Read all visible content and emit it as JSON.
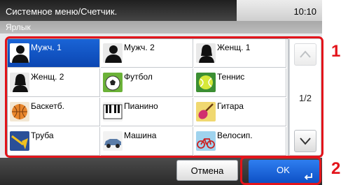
{
  "header": {
    "title": "Системное меню/Счетчик.",
    "time": "10:10"
  },
  "subheader": {
    "title": "Ярлык"
  },
  "icons": [
    {
      "label": "Мужч. 1",
      "icon": "man-silhouette-icon",
      "selected": true
    },
    {
      "label": "Мужч. 2",
      "icon": "man-silhouette-icon",
      "selected": false
    },
    {
      "label": "Женщ. 1",
      "icon": "woman-silhouette-icon",
      "selected": false
    },
    {
      "label": "Женщ. 2",
      "icon": "woman-silhouette-icon",
      "selected": false
    },
    {
      "label": "Футбол",
      "icon": "soccer-ball-icon",
      "selected": false
    },
    {
      "label": "Теннис",
      "icon": "tennis-ball-icon",
      "selected": false
    },
    {
      "label": "Баскетб.",
      "icon": "basketball-icon",
      "selected": false
    },
    {
      "label": "Пианино",
      "icon": "piano-keys-icon",
      "selected": false
    },
    {
      "label": "Гитара",
      "icon": "guitar-icon",
      "selected": false
    },
    {
      "label": "Труба",
      "icon": "trumpet-icon",
      "selected": false
    },
    {
      "label": "Машина",
      "icon": "car-icon",
      "selected": false
    },
    {
      "label": "Велосип.",
      "icon": "bicycle-icon",
      "selected": false
    }
  ],
  "scroll": {
    "page": "1/2"
  },
  "footer": {
    "cancel_label": "Отмена",
    "ok_label": "OK"
  },
  "callouts": {
    "grid_number": "1",
    "ok_number": "2"
  },
  "colors": {
    "callout": "#e3141b",
    "selected": "#0b46b2"
  }
}
